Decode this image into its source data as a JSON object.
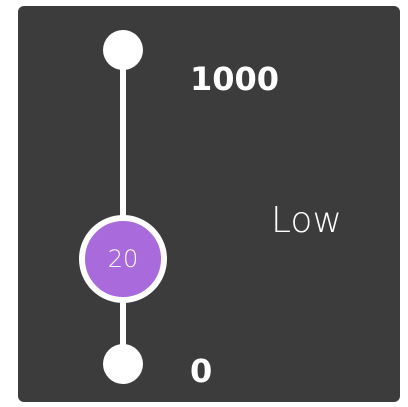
{
  "slider": {
    "max_label": "1000",
    "min_label": "0",
    "min": 0,
    "max": 1000,
    "value": 20,
    "value_label": "20",
    "level_label": "Low",
    "orientation": "vertical"
  },
  "colors": {
    "panel_background": "#3c3c3c",
    "track": "#ffffff",
    "thumb_fill": "#a96bdc",
    "text": "#ffffff"
  }
}
